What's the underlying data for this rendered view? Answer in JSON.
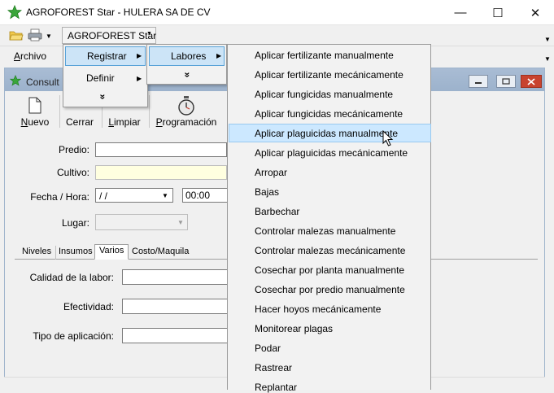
{
  "window": {
    "title": "AGROFOREST Star - HULERA SA DE CV",
    "minimize_symbol": "—",
    "maximize_symbol": "☐",
    "close_symbol": "✕"
  },
  "toolbar": {
    "app_menu_label": "AGROFOREST Star",
    "icons": [
      "open-folder-icon",
      "printer-icon"
    ]
  },
  "menubar": {
    "archivo": "Archivo"
  },
  "child_window": {
    "title": "Consult",
    "buttons": [
      "minimize",
      "maximize",
      "close"
    ]
  },
  "child_toolbar": {
    "nuevo": "Nuevo",
    "cerrar": "Cerrar",
    "limpiar": "Limpiar",
    "programacion": "Programación"
  },
  "form": {
    "predio_label": "Predio:",
    "cultivo_label": "Cultivo:",
    "fecha_label": "Fecha / Hora:",
    "fecha_value": "/ /",
    "hora_value": "00:00",
    "lugar_label": "Lugar:"
  },
  "tabs": [
    "Niveles",
    "Insumos",
    "Varios",
    "Costo/Maquila"
  ],
  "active_tab": "Varios",
  "varios": {
    "calidad_label": "Calidad de la labor:",
    "efectividad_label": "Efectividad:",
    "tipo_aplicacion_label": "Tipo de aplicación:"
  },
  "menu_level1": {
    "items": [
      "Registrar",
      "Definir"
    ],
    "highlighted": "Registrar"
  },
  "menu_level2": {
    "items": [
      "Labores"
    ],
    "highlighted": "Labores"
  },
  "menu_level3": {
    "items": [
      "Aplicar fertilizante manualmente",
      "Aplicar fertilizante mecánicamente",
      "Aplicar fungicidas manualmente",
      "Aplicar fungicidas mecánicamente",
      "Aplicar plaguicidas manualmente",
      "Aplicar plaguicidas mecánicamente",
      "Arropar",
      "Bajas",
      "Barbechar",
      "Controlar malezas manualmente",
      "Controlar malezas mecánicamente",
      "Cosechar por planta manualmente",
      "Cosechar por predio manualmente",
      "Hacer hoyos mecánicamente",
      "Monitorear plagas",
      "Podar",
      "Rastrear",
      "Replantar"
    ],
    "highlighted_index": 4
  },
  "colors": {
    "menu_highlight": "#cce8ff",
    "menu_highlight_border": "#99c9ef",
    "child_title_bar": "#a9bcd4",
    "star_green": "#3aa53a",
    "cultivo_field_bg": "#ffffe0"
  }
}
